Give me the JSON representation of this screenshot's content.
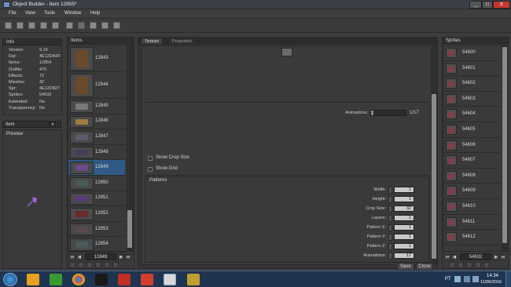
{
  "window": {
    "title": "Object Builder - Item 12855*",
    "minimize_label": "_",
    "maximize_label": "□",
    "close_label": "X"
  },
  "menu": [
    "File",
    "View",
    "Tools",
    "Window",
    "Help"
  ],
  "info": {
    "header": "Info",
    "rows": [
      {
        "label": "Version:",
        "value": "9.10"
      },
      {
        "label": "Dat:",
        "value": "4E12DAFF"
      },
      {
        "label": "Items:",
        "value": "12854"
      },
      {
        "label": "Outfits:",
        "value": "475"
      },
      {
        "label": "Effects:",
        "value": "72"
      },
      {
        "label": "Missiles:",
        "value": "42"
      },
      {
        "label": "Spr:",
        "value": "4E12D827"
      },
      {
        "label": "Sprites:",
        "value": "54632"
      },
      {
        "label": "Extended:",
        "value": "No"
      },
      {
        "label": "Transparency:",
        "value": "No"
      }
    ]
  },
  "preview": {
    "type_select": "Item",
    "header": "Preview"
  },
  "items": {
    "header": "Items",
    "rows": [
      {
        "id": "12843",
        "icon": "treasure-pile-icon"
      },
      {
        "id": "12844",
        "icon": "treasure-pile-icon"
      },
      {
        "id": "12845",
        "icon": "stone-block-icon"
      },
      {
        "id": "12846",
        "icon": "wooden-crate-icon"
      },
      {
        "id": "12847",
        "icon": "sword-icon"
      },
      {
        "id": "12848",
        "icon": "dark-blade-icon"
      },
      {
        "id": "12849",
        "icon": "purple-axe-icon"
      },
      {
        "id": "12850",
        "icon": "wand-icon"
      },
      {
        "id": "12851",
        "icon": "purple-staff-icon"
      },
      {
        "id": "12852",
        "icon": "red-rod-icon"
      },
      {
        "id": "12853",
        "icon": "crossbow-icon"
      },
      {
        "id": "12854",
        "icon": "wand-icon"
      }
    ],
    "selected": "12849",
    "current_value": "12849"
  },
  "editor": {
    "tabs": [
      "Texture",
      "Properties"
    ],
    "active_tab": "Texture",
    "animations_label": "Animations:",
    "animations_value": "1/17",
    "animations_progress": 0.06,
    "show_crop_size": "Show Crop Size",
    "show_grid": "Show Grid",
    "patterns_header": "Patterns",
    "patterns": [
      {
        "label": "Width:",
        "value": "1"
      },
      {
        "label": "Height:",
        "value": "1"
      },
      {
        "label": "Crop Size:",
        "value": "32"
      },
      {
        "label": "Layers:",
        "value": "1"
      },
      {
        "label": "Pattern X:",
        "value": "1"
      },
      {
        "label": "Pattern Y:",
        "value": "1"
      },
      {
        "label": "Pattern Z:",
        "value": "1"
      },
      {
        "label": "Animations:",
        "value": "17"
      }
    ],
    "save_label": "Save",
    "close_label": "Close"
  },
  "sprites": {
    "header": "Sprites",
    "rows": [
      "54600",
      "54601",
      "54602",
      "54603",
      "54604",
      "54605",
      "54606",
      "54607",
      "54608",
      "54609",
      "54610",
      "54611",
      "54612"
    ],
    "current_value": "54632"
  },
  "taskbar": {
    "lang": "PT",
    "time": "14:34",
    "date": "11/06/2016"
  },
  "colors": {
    "selection": "#2f5a88",
    "taskbar": "#1e3450",
    "panel": "#3a3a3a"
  }
}
